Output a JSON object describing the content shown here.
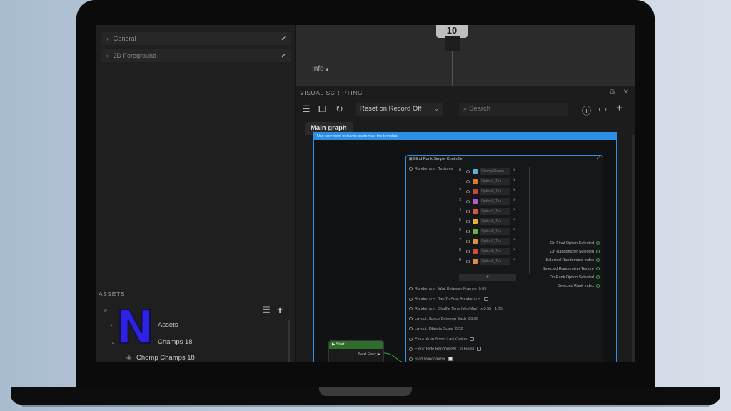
{
  "left_panel": {
    "rows": [
      {
        "label": "General",
        "checked": true
      },
      {
        "label": "2D Foreground",
        "checked": true
      }
    ],
    "assets": {
      "title": "ASSETS",
      "tree": [
        {
          "label": "Assets",
          "level": 0
        },
        {
          "label": "Champs 18",
          "level": 1
        },
        {
          "label": "Chomp Champs 18",
          "level": 2
        }
      ]
    },
    "overlay_logo": "N"
  },
  "preview": {
    "device_label": "10",
    "info_label": "Info"
  },
  "visual_scripting": {
    "title": "VISUAL SCRIPTING",
    "reset_dropdown": "Reset on Record Off",
    "search_placeholder": "Search",
    "graph_tab": "Main graph",
    "frame_caption": "Use comment below to customize the template",
    "node": {
      "title": "Blind Rank Simple Controller",
      "randomizer_textures_label": "Randomizer: Textures",
      "options": [
        {
          "idx": "0",
          "name": "ChompChamp",
          "color": "#5ab0e0"
        },
        {
          "idx": "1",
          "name": "Option1_Tex",
          "color": "#e07a2b"
        },
        {
          "idx": "2",
          "name": "Option2_Tex",
          "color": "#c9463d"
        },
        {
          "idx": "3",
          "name": "Option3_Tex",
          "color": "#b45ad4"
        },
        {
          "idx": "4",
          "name": "Option4_Tex",
          "color": "#d8593a"
        },
        {
          "idx": "5",
          "name": "Option5_Tex",
          "color": "#e7b03c"
        },
        {
          "idx": "6",
          "name": "Option6_Tex",
          "color": "#6bb04a"
        },
        {
          "idx": "7",
          "name": "Option7_Tex",
          "color": "#e2913a"
        },
        {
          "idx": "8",
          "name": "Option8_Tex",
          "color": "#d84a3a"
        },
        {
          "idx": "9",
          "name": "Option9_Tex",
          "color": "#e08b3e"
        }
      ],
      "add_symbol": "+",
      "inputs": [
        {
          "label": "Randomizer: Wait Between Frames",
          "value": "0.05"
        },
        {
          "label": "Randomizer: Tap To Stop Randomizer",
          "value": ""
        },
        {
          "label": "Randomizer: Shuffle Time (Min/Max)",
          "value": "x 0.55   ·   1.75"
        },
        {
          "label": "Layout: Space Between Each",
          "value": "80.00"
        },
        {
          "label": "Layout: Objects Scale",
          "value": "0.52"
        },
        {
          "label": "Extra: Auto Select Last Option",
          "value": ""
        },
        {
          "label": "Extra: Hide Randomizer On Finish",
          "value": ""
        },
        {
          "label": "Start Randomizer",
          "value": ""
        }
      ],
      "outputs": [
        "On Final Option Selected",
        "On Randomizer Selected",
        "Selected Randomizer Index",
        "Selected Randomizer Texture",
        "On Rank Option Selected",
        "Selected Rank Index"
      ]
    },
    "start_node": {
      "title": "Start",
      "next_label": "Next Exec"
    }
  }
}
